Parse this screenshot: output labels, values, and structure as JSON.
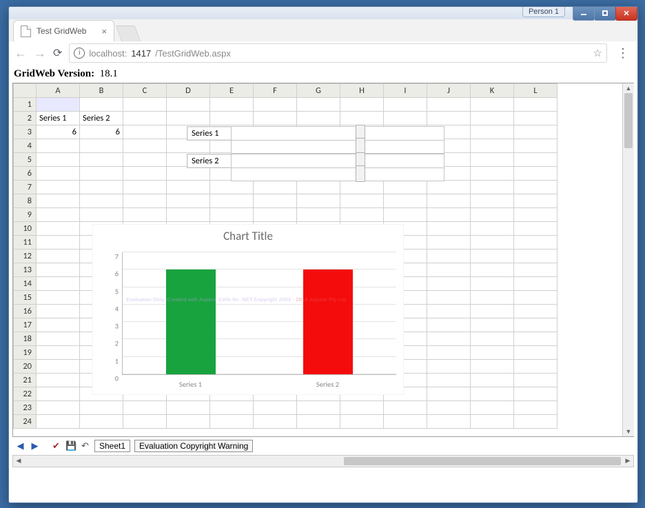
{
  "browser": {
    "person_tab": "Person 1",
    "tab_title": "Test GridWeb"
  },
  "addressbar": {
    "host": "localhost:",
    "port": "1417",
    "path": "/TestGridWeb.aspx"
  },
  "page": {
    "version_label": "GridWeb Version:",
    "version_value": "18.1"
  },
  "columns": [
    "A",
    "B",
    "C",
    "D",
    "E",
    "F",
    "G",
    "H",
    "I",
    "J",
    "K",
    "L"
  ],
  "row_count": 24,
  "cells": {
    "A2": "Series 1",
    "B2": "Series 2",
    "A3": "6",
    "B3": "6"
  },
  "floaters": {
    "label1": "Series 1",
    "label2": "Series 2"
  },
  "chart_data": {
    "type": "bar",
    "title": "Chart Title",
    "categories": [
      "Series 1",
      "Series 2"
    ],
    "values": [
      6,
      6
    ],
    "colors": [
      "#18a33e",
      "#f40c0c"
    ],
    "ylim": [
      0,
      7
    ],
    "yticks": [
      0,
      1,
      2,
      3,
      4,
      5,
      6,
      7
    ],
    "xlabel": "",
    "ylabel": "",
    "watermark_left": "Evaluation Only. Created with Aspose.Cells for .NET.Copyright 2003 - ",
    "watermark_right": "2018 Aspose Pty Ltd."
  },
  "sheetbar": {
    "tabs": [
      "Sheet1",
      "Evaluation Copyright Warning"
    ],
    "active": 0
  }
}
